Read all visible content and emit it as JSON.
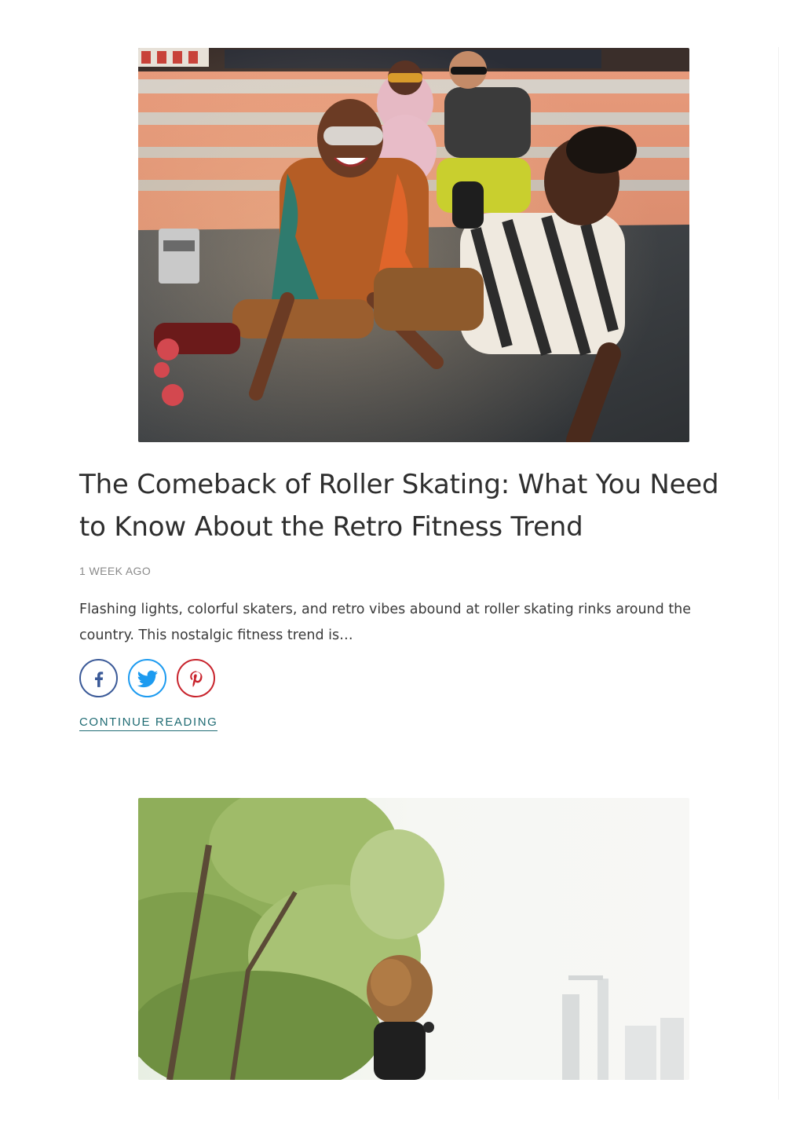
{
  "articles": [
    {
      "image_alt": "",
      "title": "The Comeback of Roller Skating: What You Need to Know About the Retro Fitness Trend",
      "date": "1 WEEK AGO",
      "excerpt": "Flashing lights, colorful skaters, and retro vibes abound at roller skating rinks around the country. This nostalgic fitness trend is…",
      "share": [
        {
          "network": "facebook",
          "icon": "facebook-icon",
          "color": "#3b5a98"
        },
        {
          "network": "twitter",
          "icon": "twitter-icon",
          "color": "#1d9bf0"
        },
        {
          "network": "pinterest",
          "icon": "pinterest-icon",
          "color": "#c8232c"
        }
      ],
      "continue_label": "CONTINUE READING"
    },
    {
      "image_alt": ""
    }
  ],
  "colors": {
    "link": "#1f6b73",
    "title": "#2e2e2e",
    "meta": "#8a8a8a"
  }
}
